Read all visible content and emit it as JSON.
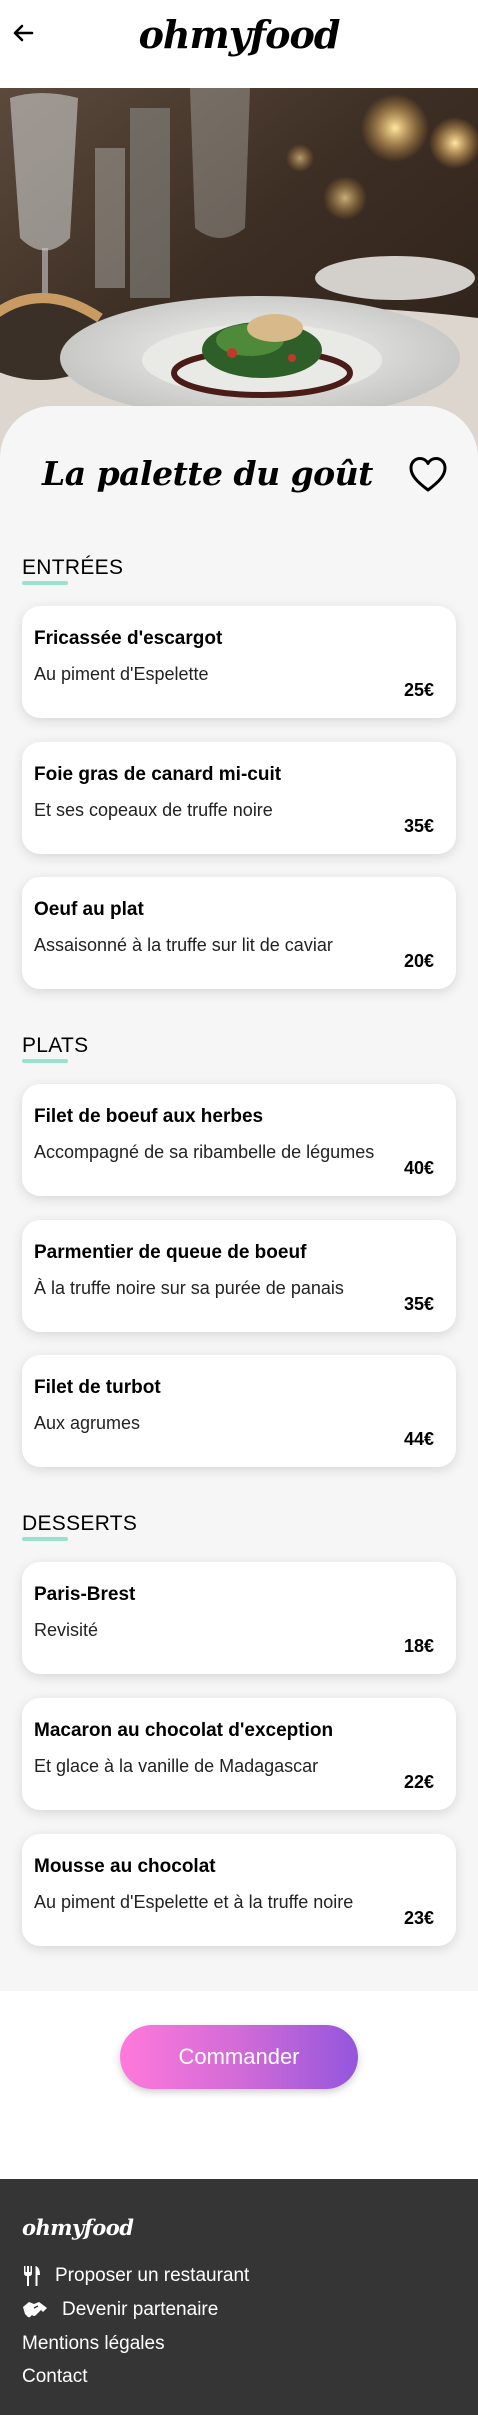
{
  "header": {
    "brand": "ohmyfood",
    "back_icon": "arrow-left-icon"
  },
  "restaurant": {
    "name": "La palette du goût",
    "favorite_icon": "heart-outline-icon"
  },
  "sections": [
    {
      "title": "ENTRÉES",
      "items": [
        {
          "name": "Fricassée d'escargot",
          "description": "Au piment d'Espelette",
          "price": "25€"
        },
        {
          "name": "Foie gras de canard mi-cuit",
          "description": "Et ses copeaux de truffe noire",
          "price": "35€"
        },
        {
          "name": "Oeuf au plat",
          "description": "Assaisonné à la truffe sur lit de caviar",
          "price": "20€"
        }
      ]
    },
    {
      "title": "PLATS",
      "items": [
        {
          "name": "Filet de boeuf aux herbes",
          "description": "Accompagné de sa ribambelle de légumes",
          "price": "40€"
        },
        {
          "name": "Parmentier de queue de boeuf",
          "description": "À la truffe noire sur sa purée de panais",
          "price": "35€"
        },
        {
          "name": "Filet de turbot",
          "description": "Aux agrumes",
          "price": "44€"
        }
      ]
    },
    {
      "title": "DESSERTS",
      "items": [
        {
          "name": "Paris-Brest",
          "description": "Revisité",
          "price": "18€"
        },
        {
          "name": "Macaron au chocolat d'exception",
          "description": "Et glace à la vanille de Madagascar",
          "price": "22€"
        },
        {
          "name": "Mousse au chocolat",
          "description": "Au piment d'Espelette et à la truffe noire",
          "price": "23€"
        }
      ]
    }
  ],
  "order": {
    "label": "Commander"
  },
  "footer": {
    "brand": "ohmyfood",
    "links": [
      {
        "label": "Proposer un restaurant",
        "icon": "utensils-icon"
      },
      {
        "label": "Devenir partenaire",
        "icon": "handshake-icon"
      },
      {
        "label": "Mentions légales",
        "icon": ""
      },
      {
        "label": "Contact",
        "icon": ""
      }
    ]
  },
  "colors": {
    "accent_underline": "#99e2d0",
    "button_gradient_start": "#ff79da",
    "button_gradient_end": "#9356dc",
    "footer_background": "#353535",
    "page_background": "#f6f6f6"
  }
}
